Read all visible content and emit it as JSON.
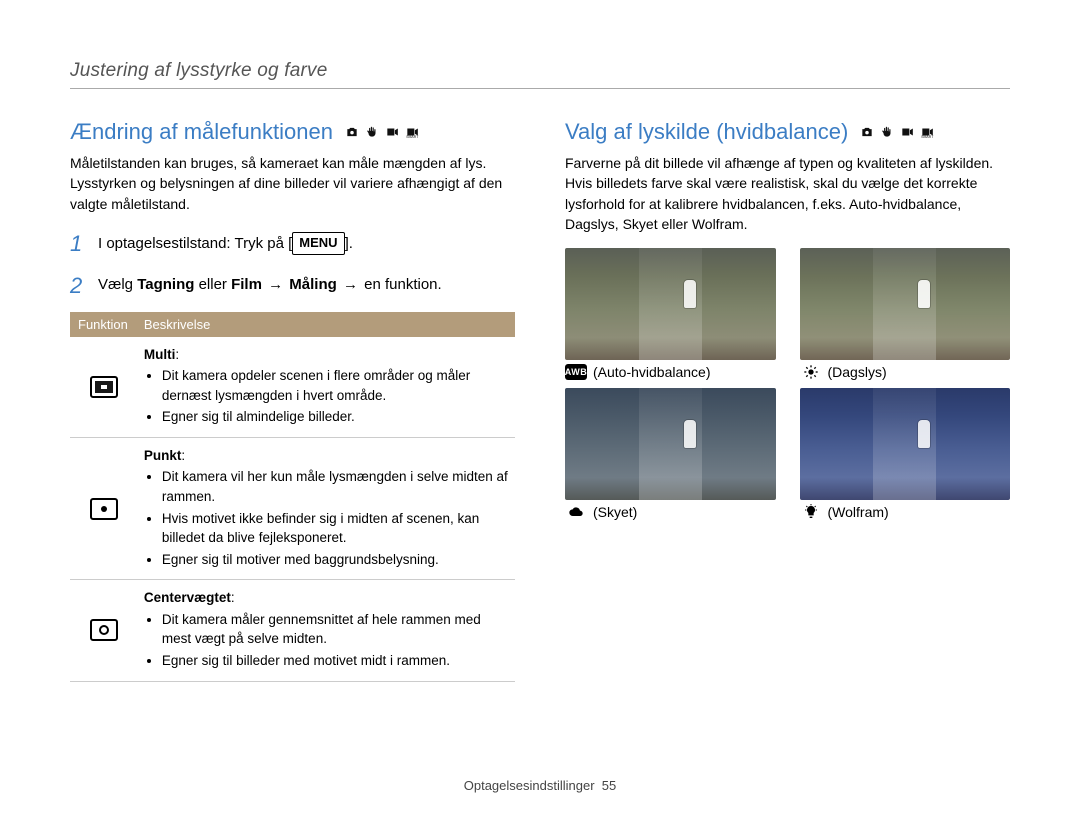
{
  "page_header": "Justering af lysstyrke og farve",
  "footer": {
    "label": "Optagelsesindstillinger",
    "page": "55"
  },
  "left": {
    "title": "Ændring af målefunktionen",
    "intro": "Måletilstanden kan bruges, så kameraet kan måle mængden af lys. Lysstyrken og belysningen af dine billeder vil variere afhængigt af den valgte måletilstand.",
    "step1_prefix": "I optagelsestilstand: Tryk på [",
    "step1_button": "MENU",
    "step1_suffix": "].",
    "step2_prefix": "Vælg ",
    "step2_bold1": "Tagning",
    "step2_mid1": " eller ",
    "step2_bold2": "Film",
    "step2_arrow1": " → ",
    "step2_bold3": "Måling",
    "step2_arrow2": " → ",
    "step2_end": "en funktion.",
    "table": {
      "h1": "Funktion",
      "h2": "Beskrivelse",
      "rows": [
        {
          "icon": "multi",
          "title": "Multi",
          "bullets": [
            "Dit kamera opdeler scenen i flere områder og måler dernæst lysmængden i hvert område.",
            "Egner sig til almindelige billeder."
          ]
        },
        {
          "icon": "spot",
          "title": "Punkt",
          "bullets": [
            "Dit kamera vil her kun måle lysmængden i selve midten af rammen.",
            "Hvis motivet ikke befinder sig i midten af scenen, kan billedet da blive fejleksponeret.",
            "Egner sig til motiver med baggrundsbelysning."
          ]
        },
        {
          "icon": "center",
          "title": "Centervægtet",
          "bullets": [
            "Dit kamera måler gennemsnittet af hele rammen med mest vægt på selve midten.",
            "Egner sig til billeder med motivet midt i rammen."
          ]
        }
      ]
    }
  },
  "right": {
    "title": "Valg af lyskilde (hvidbalance)",
    "intro": "Farverne på dit billede vil afhænge af typen og kvaliteten af lyskilden. Hvis billedets farve skal være realistisk, skal du vælge det korrekte lysforhold for at kalibrere hvidbalancen, f.eks. Auto-hvidbalance, Dagslys, Skyet eller Wolfram.",
    "items": [
      {
        "id": "awb",
        "label": "(Auto-hvidbalance)"
      },
      {
        "id": "day",
        "label": "(Dagslys)"
      },
      {
        "id": "cloud",
        "label": "(Skyet)"
      },
      {
        "id": "tung",
        "label": "(Wolfram)"
      }
    ]
  }
}
